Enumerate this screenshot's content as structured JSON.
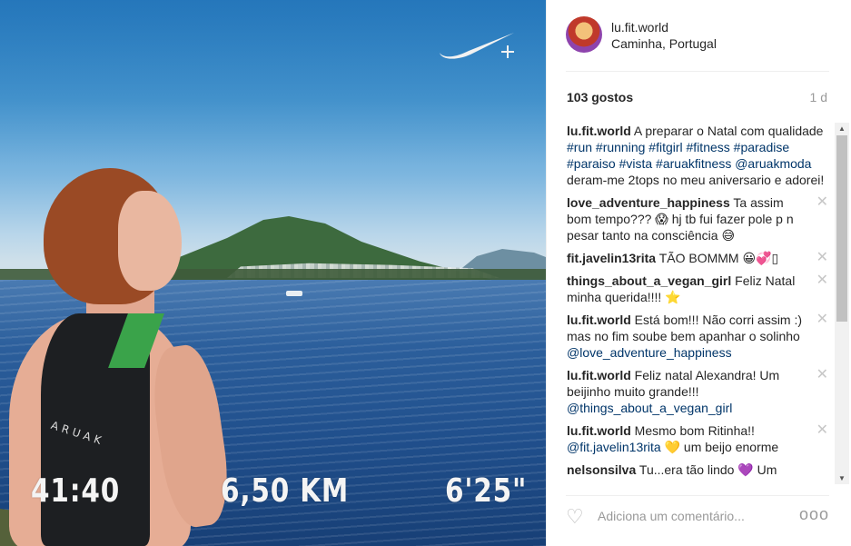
{
  "post": {
    "username": "lu.fit.world",
    "location": "Caminha, Portugal",
    "likes": "103 gostos",
    "time_ago": "1 d"
  },
  "photo": {
    "top_label": "ARUAK",
    "stats": {
      "time": "41:40",
      "distance": "6,50 KM",
      "pace": "6'25\""
    }
  },
  "caption": {
    "author": "lu.fit.world",
    "text1": "A preparar o Natal com qualidade",
    "hashtags": "#run #running #fitgirl #fitness #paradise #paraiso #vista #aruakfitness",
    "mention": "@aruakmoda",
    "text2": "deram-me 2tops no meu aniversario e adorei!"
  },
  "comments": [
    {
      "author": "love_adventure_happiness",
      "text": "Ta assim bom tempo??? 😱 hj tb fui fazer pole p n pesar tanto na consciência 😅"
    },
    {
      "author": "fit.javelin13rita",
      "text": "TÃO BOMMM 😀💞▯"
    },
    {
      "author": "things_about_a_vegan_girl",
      "text": "Feliz Natal minha querida!!!! ⭐"
    },
    {
      "author": "lu.fit.world",
      "text": "Está bom!!! Não corri assim :) mas no fim soube bem apanhar o solinho",
      "mention": "@love_adventure_happiness"
    },
    {
      "author": "lu.fit.world",
      "text": "Feliz natal Alexandra! Um beijinho muito grande!!!",
      "mention": "@things_about_a_vegan_girl"
    },
    {
      "author": "lu.fit.world",
      "text": "Mesmo bom Ritinha!!",
      "mention": "@fit.javelin13rita",
      "text_after": "💛 um beijo enorme"
    },
    {
      "author": "nelsonsilva",
      "text": "Tu...era tão lindo 💜 Um"
    }
  ],
  "footer": {
    "add_comment_placeholder": "Adiciona um comentário...",
    "more_label": "ooo"
  },
  "colors": {
    "link": "#003569",
    "muted": "#999999"
  },
  "icons": {
    "brand": "nike-swoosh-icon",
    "plus": "plus-icon",
    "heart": "heart-outline-icon",
    "delete": "close-icon",
    "more": "ellipsis-icon"
  }
}
